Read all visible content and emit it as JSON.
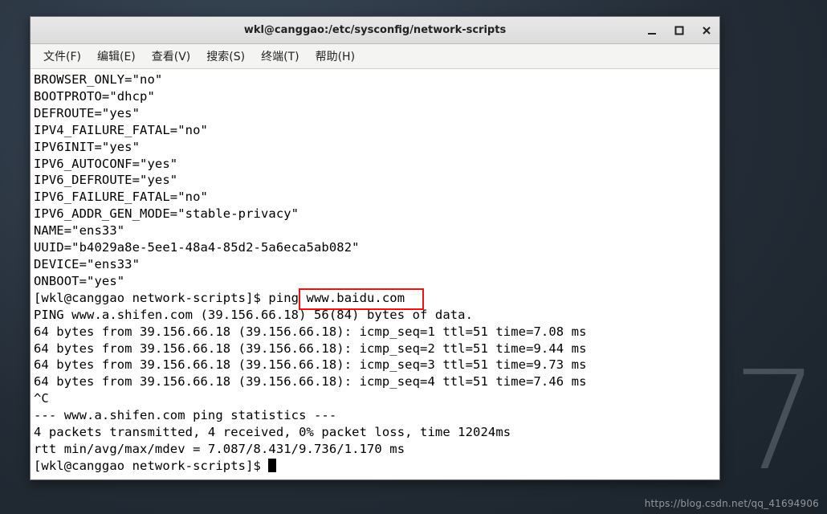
{
  "window": {
    "title": "wkl@canggao:/etc/sysconfig/network-scripts"
  },
  "menu": {
    "file": "文件(F)",
    "edit": "编辑(E)",
    "view": "查看(V)",
    "search": "搜索(S)",
    "term": "终端(T)",
    "help": "帮助(H)"
  },
  "terminal": {
    "lines": [
      "BROWSER_ONLY=\"no\"",
      "BOOTPROTO=\"dhcp\"",
      "DEFROUTE=\"yes\"",
      "IPV4_FAILURE_FATAL=\"no\"",
      "IPV6INIT=\"yes\"",
      "IPV6_AUTOCONF=\"yes\"",
      "IPV6_DEFROUTE=\"yes\"",
      "IPV6_FAILURE_FATAL=\"no\"",
      "IPV6_ADDR_GEN_MODE=\"stable-privacy\"",
      "NAME=\"ens33\"",
      "UUID=\"b4029a8e-5ee1-48a4-85d2-5a6eca5ab082\"",
      "DEVICE=\"ens33\"",
      "ONBOOT=\"yes\"",
      "[wkl@canggao network-scripts]$ ping www.baidu.com",
      "PING www.a.shifen.com (39.156.66.18) 56(84) bytes of data.",
      "64 bytes from 39.156.66.18 (39.156.66.18): icmp_seq=1 ttl=51 time=7.08 ms",
      "64 bytes from 39.156.66.18 (39.156.66.18): icmp_seq=2 ttl=51 time=9.44 ms",
      "64 bytes from 39.156.66.18 (39.156.66.18): icmp_seq=3 ttl=51 time=9.73 ms",
      "64 bytes from 39.156.66.18 (39.156.66.18): icmp_seq=4 ttl=51 time=7.46 ms",
      "^C",
      "--- www.a.shifen.com ping statistics ---",
      "4 packets transmitted, 4 received, 0% packet loss, time 12024ms",
      "rtt min/avg/max/mdev = 7.087/8.431/9.736/1.170 ms"
    ],
    "prompt": "[wkl@canggao network-scripts]$ ",
    "highlight_text": "www.baidu.com"
  },
  "watermark": "https://blog.csdn.net/qq_41694906",
  "decoration": "7"
}
